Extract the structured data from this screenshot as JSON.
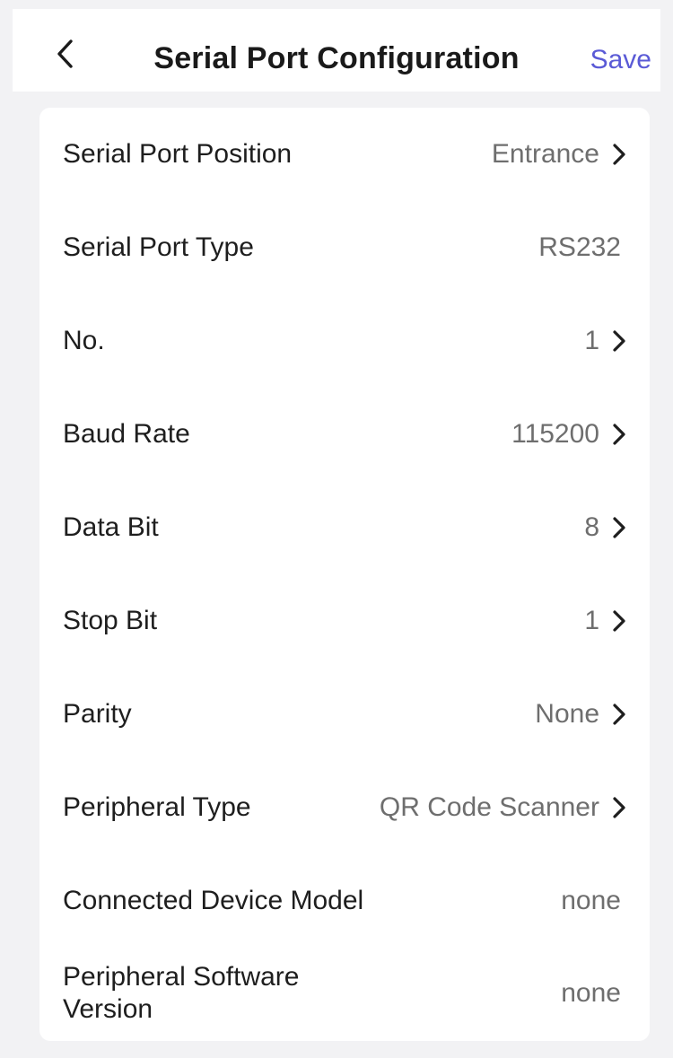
{
  "header": {
    "title": "Serial Port Configuration",
    "save_label": "Save",
    "back_icon": "chevron-left-icon"
  },
  "settings": [
    {
      "label": "Serial Port Position",
      "value": "Entrance",
      "has_chevron": true
    },
    {
      "label": "Serial Port Type",
      "value": "RS232",
      "has_chevron": false
    },
    {
      "label": "No.",
      "value": "1",
      "has_chevron": true
    },
    {
      "label": "Baud Rate",
      "value": "115200",
      "has_chevron": true
    },
    {
      "label": "Data Bit",
      "value": "8",
      "has_chevron": true
    },
    {
      "label": "Stop Bit",
      "value": "1",
      "has_chevron": true
    },
    {
      "label": "Parity",
      "value": "None",
      "has_chevron": true
    },
    {
      "label": "Peripheral Type",
      "value": "QR Code Scanner",
      "has_chevron": true
    },
    {
      "label": "Connected Device Model",
      "value": "none",
      "has_chevron": false
    },
    {
      "label": "Peripheral Software Version",
      "value": "none",
      "has_chevron": false
    }
  ],
  "colors": {
    "accent": "#5a5ad6",
    "background": "#f2f2f4",
    "card": "#ffffff",
    "label_text": "#1e1e1e",
    "value_text": "#6e6e6e"
  }
}
